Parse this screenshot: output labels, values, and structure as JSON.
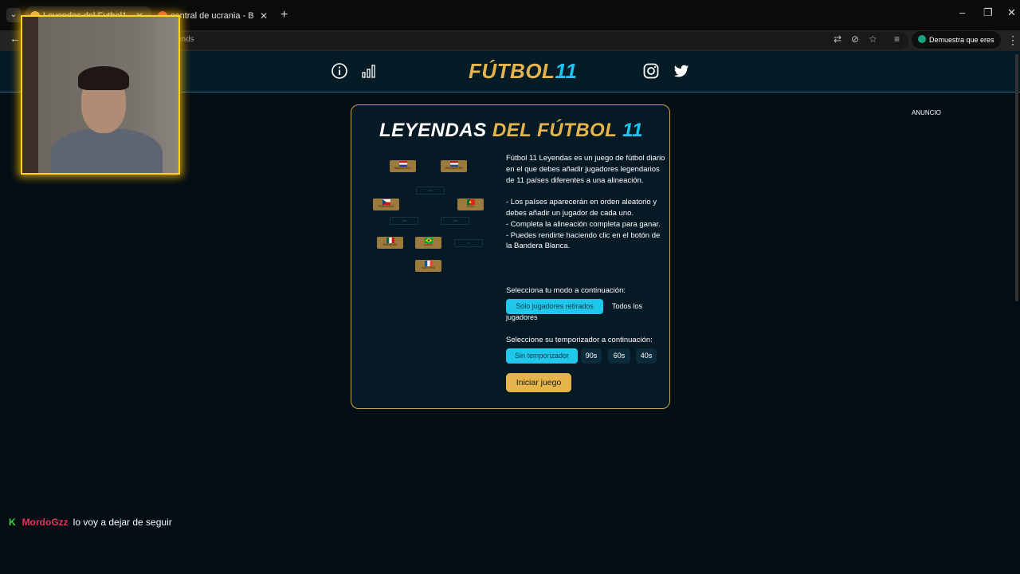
{
  "browser": {
    "tabs": [
      {
        "title": "Leyendas del Futbol11 - Juego",
        "active": true,
        "favicon_color": "#e5b54b"
      },
      {
        "title": "central de ucrania - Buscar con",
        "active": false,
        "favicon_color": "#ea4335"
      }
    ],
    "address_partial": "ends",
    "profile_label": "Demuestra que eres tú",
    "new_tab_glyph": "+",
    "close_glyph": "✕"
  },
  "site": {
    "logo_part1": "FÚTBOL",
    "logo_part2": "11",
    "ad_label": "ANUNCIO",
    "header_icons": [
      "info-icon",
      "stats-icon",
      "instagram-icon",
      "twitter-icon"
    ]
  },
  "card": {
    "title_part1": "LEYENDAS",
    "title_part2": "DEL FÚTBOL",
    "title_part3": "11",
    "description": [
      "Fútbol 11 Leyendas es un juego de fútbol diario en el que debes añadir jugadores legendarios de 11 países diferentes a una alineación.",
      "- Los países aparecerán en orden aleatorio y debes añadir un jugador de cada uno.",
      "- Completa la alineación completa para ganar.",
      "- Puedes rendirte haciendo clic en el botón de la Bandera Blanca."
    ],
    "mode_label": "Selecciona tu modo a continuación:",
    "modes": [
      {
        "label": "Sólo jugadores retirados",
        "selected": true
      },
      {
        "label": "Todos los",
        "selected": false
      }
    ],
    "mode_wrap": "jugadores",
    "timer_label": "Seleccione su temporizador a continuación:",
    "timers": [
      {
        "label": "Sin temporizador",
        "selected": true
      },
      {
        "label": "90s",
        "selected": false
      },
      {
        "label": "60s",
        "selected": false
      },
      {
        "label": "40s",
        "selected": false
      }
    ],
    "start_label": "Iniciar juego",
    "players": [
      {
        "name": "MANDZUKIC",
        "flag": "croatia"
      },
      {
        "name": "VAN BASTEN",
        "flag": "netherlands"
      },
      {
        "name": "POBORSKY",
        "flag": "czech"
      },
      {
        "name": "FIGO",
        "flag": "portugal"
      },
      {
        "name": "MARQUEZ",
        "flag": "mexico"
      },
      {
        "name": "LUCIO",
        "flag": "brazil"
      },
      {
        "name": "BARTHEZ",
        "flag": "france"
      }
    ],
    "slots": [
      "CAM",
      "CDM",
      "CDM",
      "LB"
    ]
  },
  "chat": {
    "badge": "K",
    "user": "MordoGzz",
    "message": "lo voy a dejar de seguir"
  },
  "colors": {
    "background": "#030d14",
    "accent_gold": "#e5b54b",
    "accent_cyan": "#1ec5ef",
    "chat_user": "#f02d59",
    "chat_badge": "#3ad64a"
  }
}
